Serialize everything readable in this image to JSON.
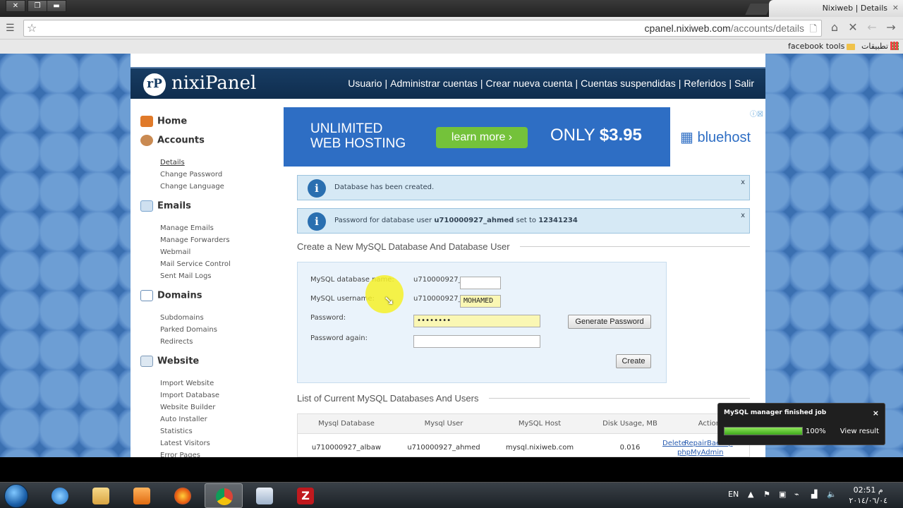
{
  "window": {
    "tab_title": "Nixiweb | Details",
    "tab_close": "×"
  },
  "toolbar": {
    "url_host": "cpanel.nixiweb.com",
    "url_path": "/accounts/details"
  },
  "bookmarks": {
    "facebook_tools": "facebook tools",
    "apps": "تطبيقات"
  },
  "header": {
    "logo_mark": "rP",
    "logo_text": "nixiPanel",
    "nav": [
      "Usuario",
      "Administrar cuentas",
      "Crear nueva cuenta",
      "Cuentas suspendidas",
      "Referidos",
      "Salir"
    ]
  },
  "sidebar": {
    "home": "Home",
    "accounts": "Accounts",
    "accounts_items": [
      "Details",
      "Change Password",
      "Change Language"
    ],
    "emails": "Emails",
    "emails_items": [
      "Manage Emails",
      "Manage Forwarders",
      "Webmail",
      "Mail Service Control",
      "Sent Mail Logs"
    ],
    "domains": "Domains",
    "domains_items": [
      "Subdomains",
      "Parked Domains",
      "Redirects"
    ],
    "website": "Website",
    "website_items": [
      "Import Website",
      "Import Database",
      "Website Builder",
      "Auto Installer",
      "Statistics",
      "Latest Visitors",
      "Error Pages"
    ]
  },
  "banner": {
    "line1": "UNLIMITED",
    "line2": "WEB HOSTING",
    "learn_more": "learn more  ›",
    "only": "ONLY",
    "price": "$3.95",
    "brand": "bluehost"
  },
  "alerts": [
    {
      "text": "Database has been created.",
      "close": "x"
    },
    {
      "prefix": "Password for database user ",
      "user": "u710000927_ahmed",
      "mid": " set to ",
      "password": "12341234",
      "close": "x"
    }
  ],
  "create_section": {
    "title": "Create a New MySQL Database And Database User",
    "db_name_label": "MySQL database name:",
    "username_label": "MySQL username:",
    "password_label": "Password:",
    "password_again_label": "Password again:",
    "prefix": "u710000927_",
    "username_value": "MOHAMED",
    "password_value": "••••••••",
    "generate_label": "Generate Password",
    "create_label": "Create"
  },
  "list_section": {
    "title": "List of Current MySQL Databases And Users",
    "columns": [
      "Mysql Database",
      "Mysql User",
      "MySQL Host",
      "Disk Usage, MB",
      "Actions"
    ],
    "row": {
      "database": "u710000927_albaw",
      "user": "u710000927_ahmed",
      "host": "mysql.nixiweb.com",
      "disk": "0.016",
      "actions": [
        "Delete",
        "Repair",
        "Backup",
        "phpMyAdmin"
      ]
    }
  },
  "notification": {
    "title": "MySQL manager finished job",
    "progress": 100,
    "progress_label": "100%",
    "view_result": "View result",
    "close": "×"
  },
  "taskbar": {
    "lang": "EN",
    "time": "02:51 م",
    "date": "٢٠١٤/٠٦/٠٤"
  },
  "colors": {
    "header": "#173c63",
    "banner": "#2e6ec4",
    "learn_more": "#74c23a",
    "alert_bg": "#d6e9f5"
  }
}
